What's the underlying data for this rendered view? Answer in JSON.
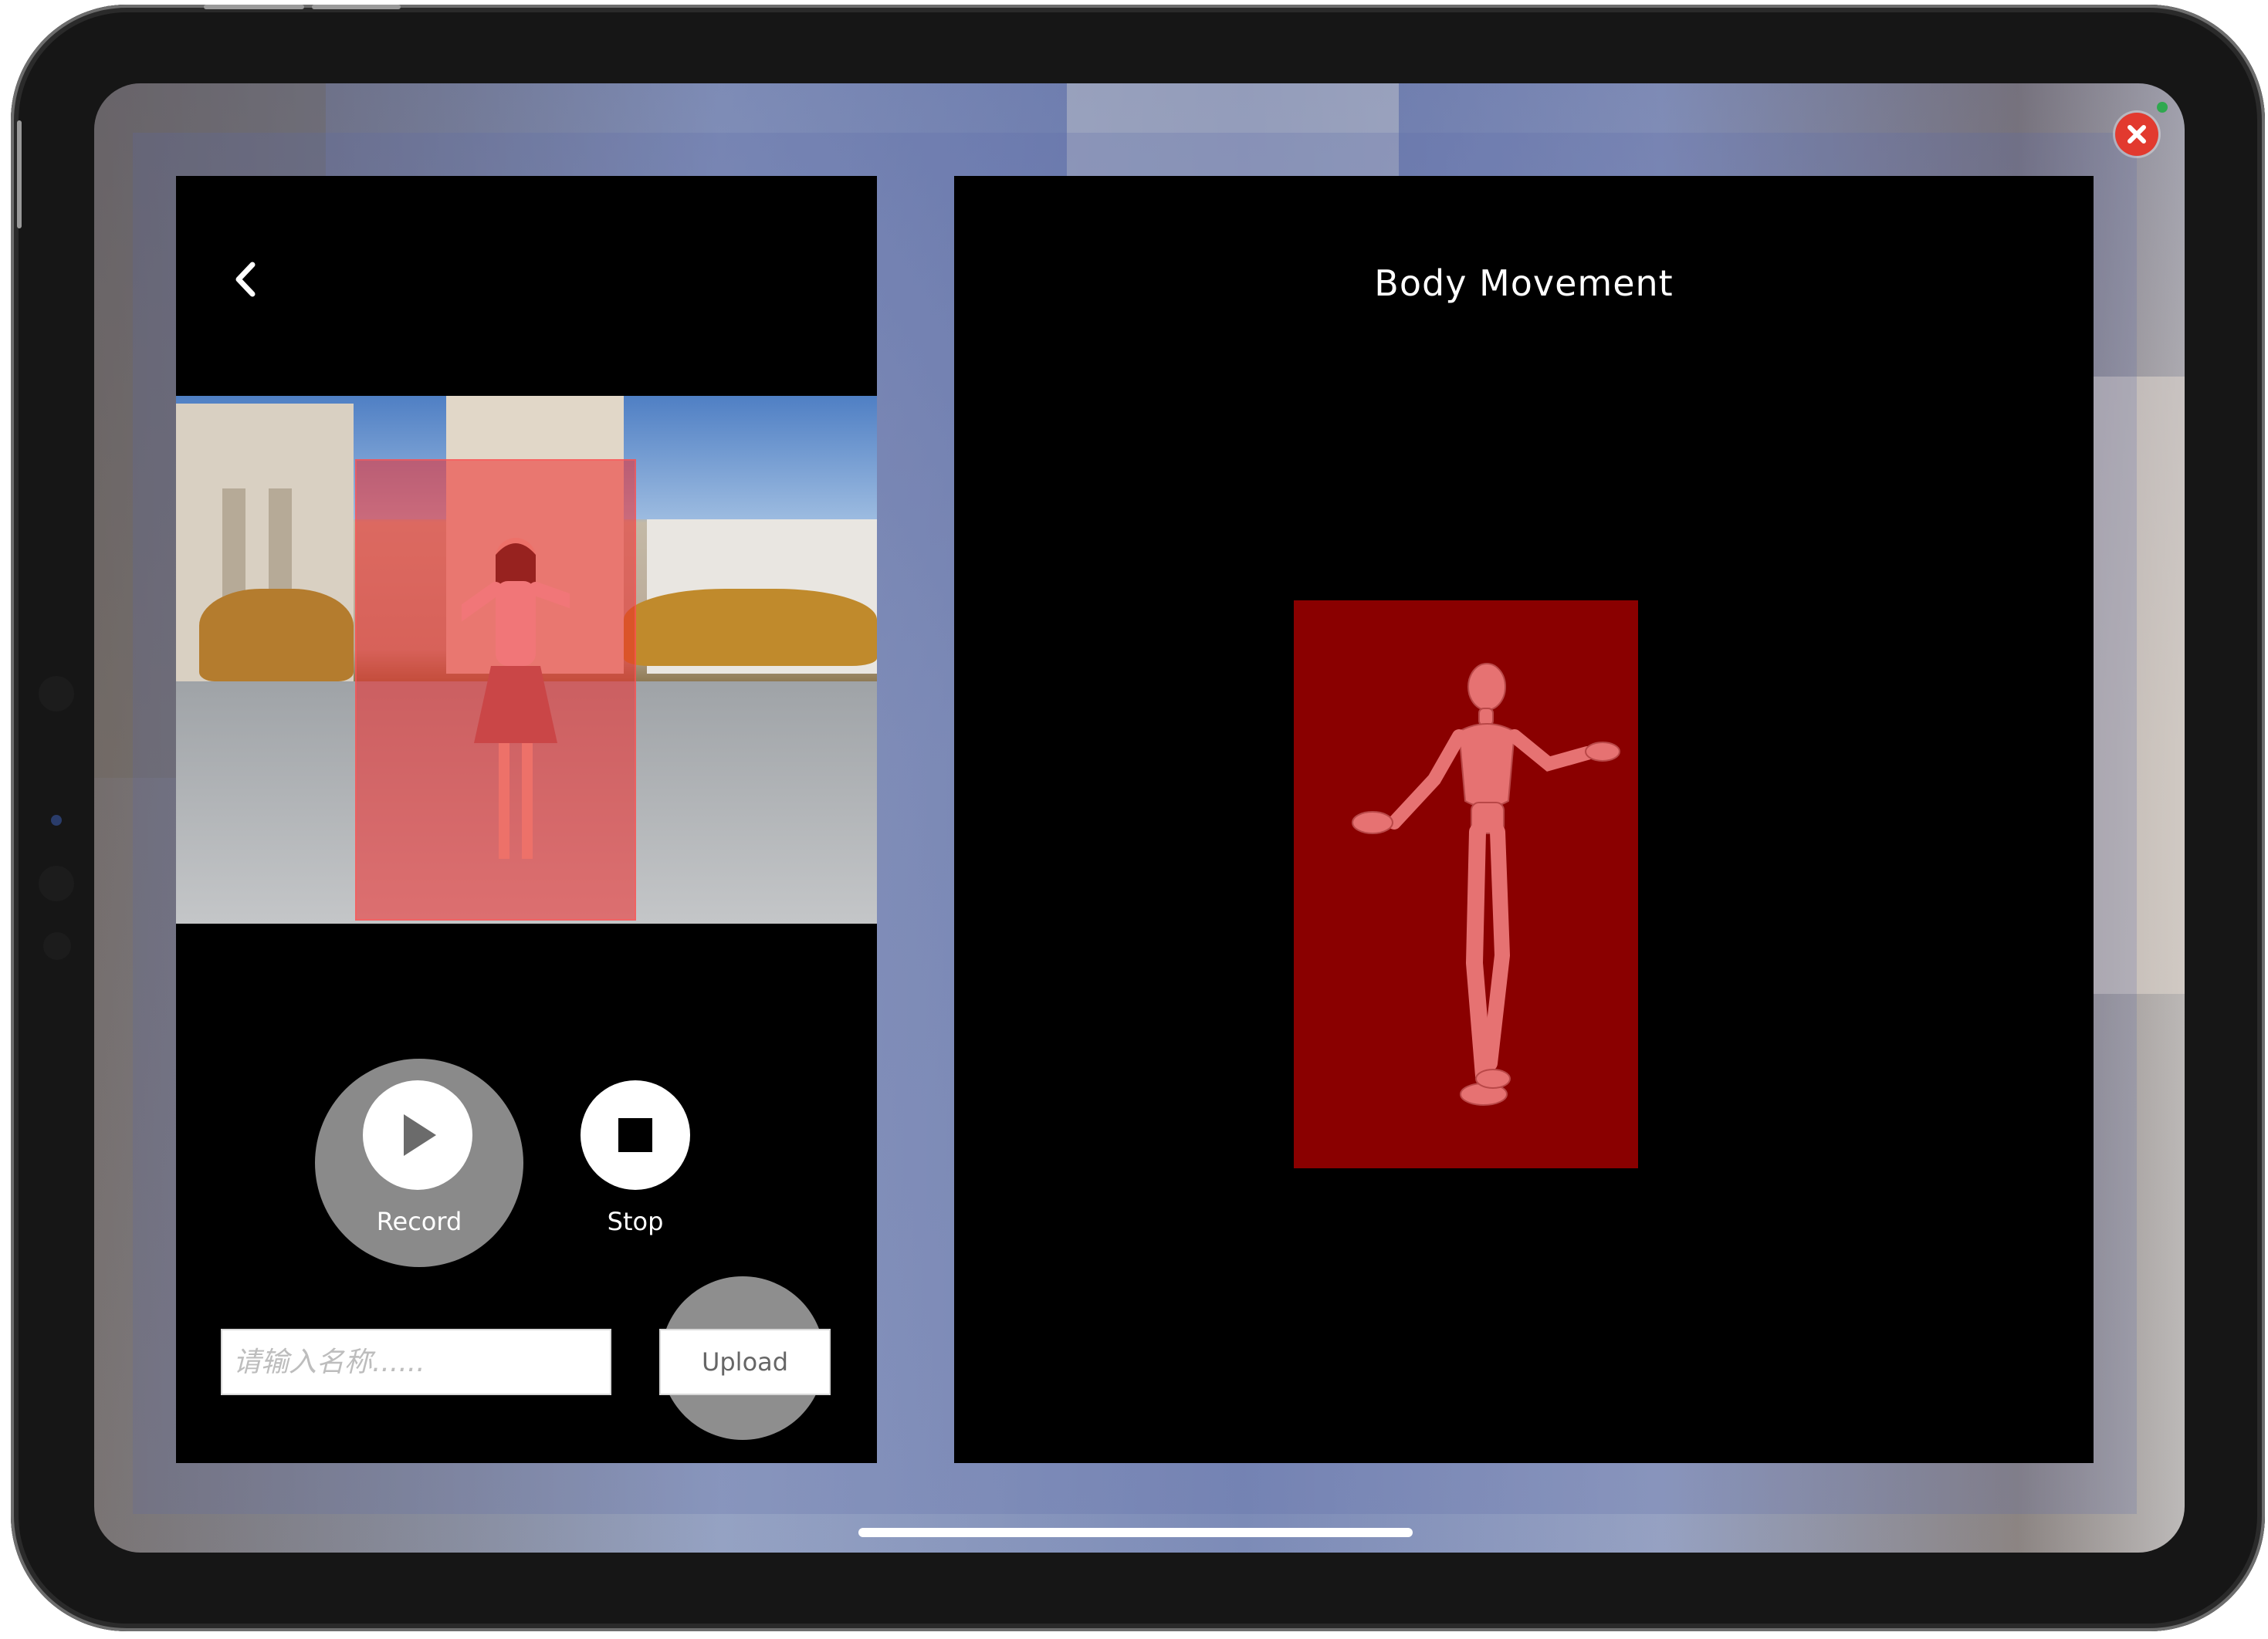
{
  "left_panel": {
    "back_icon": "chevron-left-icon",
    "record_label": "Record",
    "stop_label": "Stop",
    "name_input_placeholder": "请输入名称......",
    "name_input_value": "",
    "upload_label": "Upload"
  },
  "right_panel": {
    "title": "Body Movement"
  },
  "window": {
    "close_icon": "close-icon"
  },
  "colors": {
    "panel_bg": "#000000",
    "detection_overlay": "#f02828",
    "model_box": "#8a0000",
    "close_button": "#e23a2f"
  }
}
